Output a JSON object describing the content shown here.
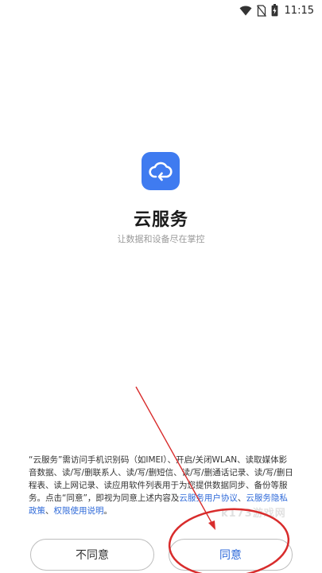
{
  "status": {
    "time": "11:15",
    "icons": [
      "wifi-icon",
      "no-sim-icon",
      "battery-charging-icon"
    ]
  },
  "app": {
    "icon": "cloud-sync-icon",
    "name": "云服务",
    "tagline": "让数据和设备尽在掌控"
  },
  "notice": {
    "text_before": "“云服务”需访问手机识别码（如IMEI）、开启/关闭WLAN、读取媒体影音数据、读/写/删联系人、读/写/删短信、读/写/删通话记录、读/写/删日程表、读上网记录、读应用软件列表用于为您提供数据同步、备份等服务。点击“同意”，即视为同意上述内容及",
    "link_user_agreement": "云服务用户协议",
    "sep1": "、",
    "link_privacy_policy": "云服务隐私政策",
    "sep2": "、",
    "link_permission_note": "权限使用说明",
    "text_end": "。"
  },
  "buttons": {
    "disagree": "不同意",
    "agree": "同意"
  },
  "watermark": "k173游戏网",
  "colors": {
    "accent": "#2f6ad9",
    "icon_bg": "#3f7bf0",
    "annotation": "#d82c2c"
  }
}
